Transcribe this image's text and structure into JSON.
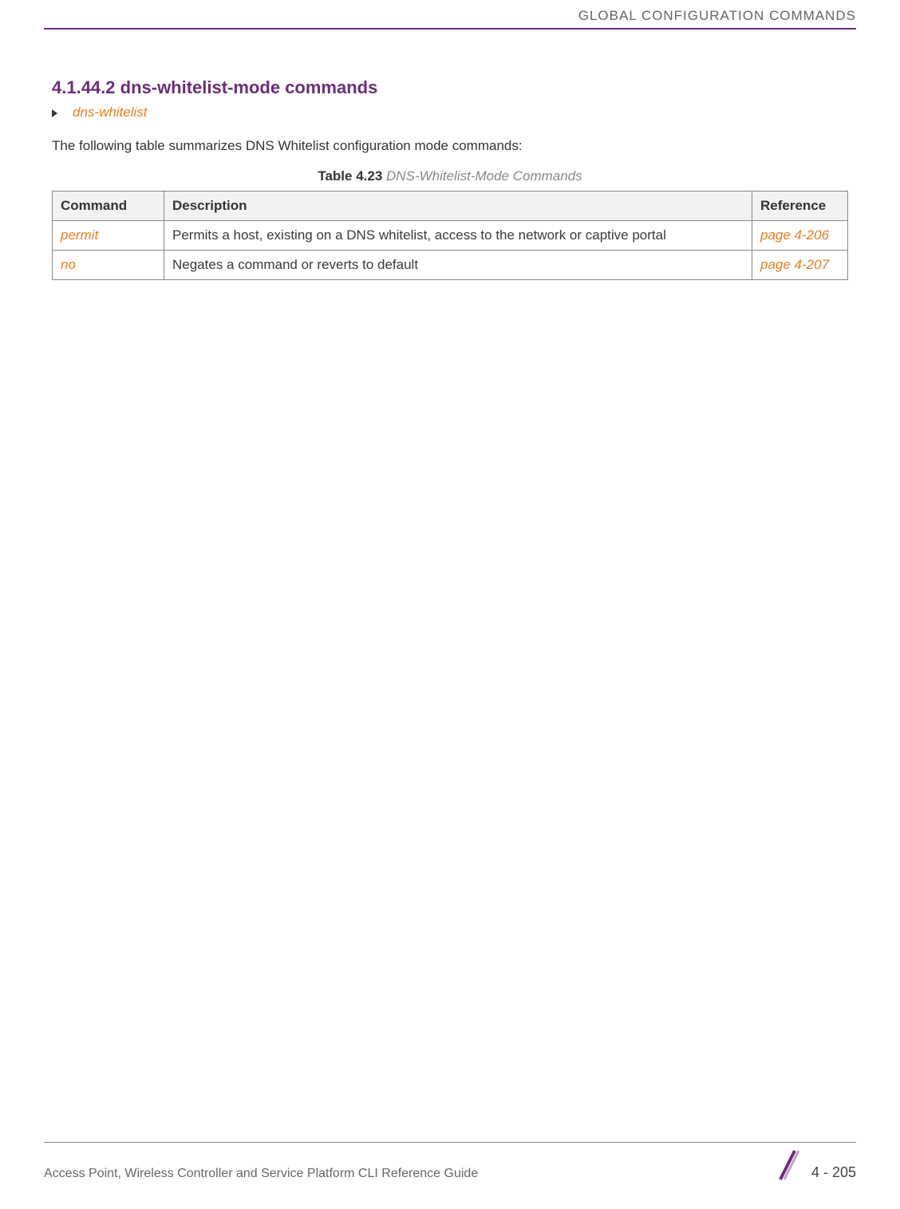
{
  "header": {
    "chapter_title": "GLOBAL CONFIGURATION COMMANDS"
  },
  "section": {
    "heading": "4.1.44.2 dns-whitelist-mode commands",
    "breadcrumb": "dns-whitelist",
    "intro": "The following table summarizes DNS Whitelist configuration mode commands:"
  },
  "table": {
    "caption_bold": "Table 4.23",
    "caption_italic": "DNS-Whitelist-Mode Commands",
    "headers": {
      "command": "Command",
      "description": "Description",
      "reference": "Reference"
    },
    "rows": [
      {
        "command": "permit",
        "description": "Permits a host, existing on a DNS whitelist, access to the network or captive portal",
        "reference": "page 4-206"
      },
      {
        "command": "no",
        "description": "Negates a command or reverts to default",
        "reference": "page 4-207"
      }
    ]
  },
  "footer": {
    "guide_title": "Access Point, Wireless Controller and Service Platform CLI Reference Guide",
    "page_number": "4 - 205"
  }
}
